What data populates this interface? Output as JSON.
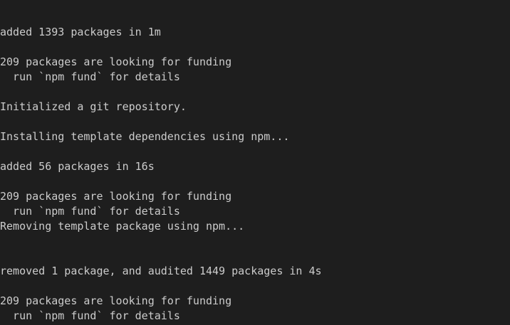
{
  "terminal": {
    "lines": [
      "added 1393 packages in 1m",
      "",
      "209 packages are looking for funding",
      "  run `npm fund` for details",
      "",
      "Initialized a git repository.",
      "",
      "Installing template dependencies using npm...",
      "",
      "added 56 packages in 16s",
      "",
      "209 packages are looking for funding",
      "  run `npm fund` for details",
      "Removing template package using npm...",
      "",
      "",
      "removed 1 package, and audited 1449 packages in 4s",
      "",
      "209 packages are looking for funding",
      "  run `npm fund` for details"
    ]
  },
  "colors": {
    "background": "#1e1e1e",
    "foreground": "#cccccc"
  }
}
